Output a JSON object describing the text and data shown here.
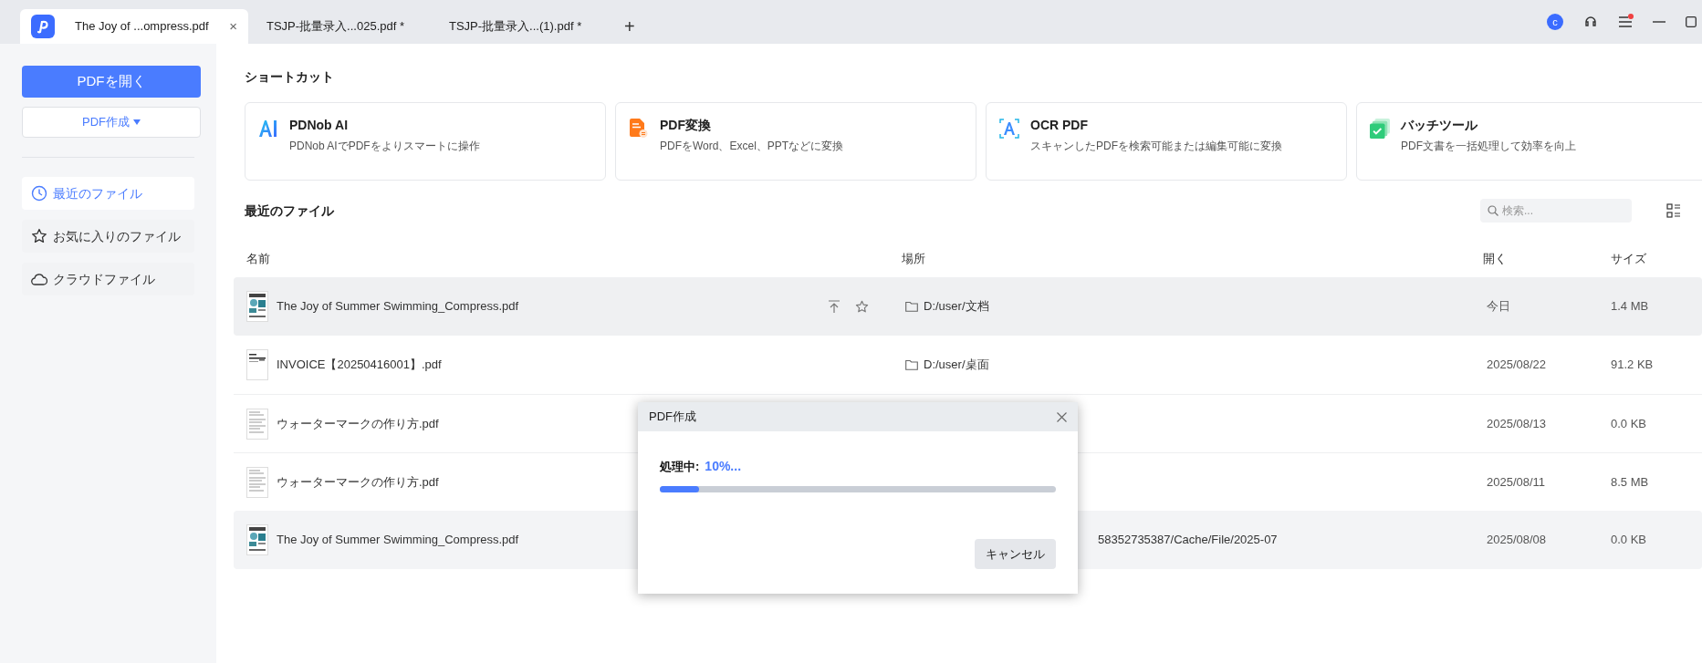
{
  "tabs": [
    {
      "title": "The Joy of ...ompress.pdf",
      "selected": true,
      "close": "×"
    },
    {
      "title": "TSJP-批量录入...025.pdf *",
      "selected": false
    },
    {
      "title": "TSJP-批量录入...(1).pdf *",
      "selected": false
    }
  ],
  "new_tab": "+",
  "titlebar": {
    "avatar": "c",
    "notification": true
  },
  "sidebar": {
    "open_button": "PDFを開く",
    "create_button": "PDF作成",
    "items": [
      {
        "label": "最近のファイル",
        "kind": "clock",
        "selected": true
      },
      {
        "label": "お気に入りのファイル",
        "kind": "star",
        "selected": false
      },
      {
        "label": "クラウドファイル",
        "kind": "cloud",
        "selected": false
      }
    ]
  },
  "shortcuts": {
    "title": "ショートカット",
    "cards": [
      {
        "kind": "ai",
        "title": "PDNob AI",
        "description": "PDNob AIでPDFをよりスマートに操作"
      },
      {
        "kind": "convert",
        "title": "PDF変換",
        "description": "PDFをWord、Excel、PPTなどに変換"
      },
      {
        "kind": "ocr",
        "title": "OCR PDF",
        "description": "スキャンしたPDFを検索可能または編集可能に変換"
      },
      {
        "kind": "batch",
        "title": "バッチツール",
        "description": "PDF文書を一括処理して効率を向上"
      }
    ]
  },
  "recent": {
    "title": "最近のファイル",
    "search_placeholder": "検索...",
    "columns": [
      "名前",
      "場所",
      "開く",
      "サイズ"
    ],
    "rows": [
      {
        "name": "The Joy of Summer Swimming_Compress.pdf",
        "kind": "photo",
        "location": "D:/user/文档",
        "location_partial": false,
        "opened": "今日",
        "size": "1.4 MB",
        "selected": true,
        "hovered": false
      },
      {
        "name": "INVOICE【20250416001】.pdf",
        "kind": "invoice",
        "location": "D:/user/桌面",
        "location_partial": false,
        "opened": "2025/08/22",
        "size": "91.2 KB",
        "selected": false,
        "hovered": false
      },
      {
        "name": "ウォーターマークの作り方.pdf",
        "kind": "text",
        "opened": "2025/08/13",
        "size": "0.0 KB",
        "selected": false,
        "hovered": false
      },
      {
        "name": "ウォーターマークの作り方.pdf",
        "kind": "text",
        "opened": "2025/08/11",
        "size": "8.5 MB",
        "selected": false,
        "hovered": false
      },
      {
        "name": "The Joy of Summer Swimming_Compress.pdf",
        "kind": "photo",
        "location": "58352735387/Cache/File/2025-07",
        "location_partial": true,
        "opened": "2025/08/08",
        "size": "0.0 KB",
        "selected": false,
        "hovered": true
      }
    ]
  },
  "dialog": {
    "title": "PDF作成",
    "status_label": "処理中:",
    "status_value": "10%...",
    "level": 0.1,
    "cancel_button": "キャンセル"
  }
}
